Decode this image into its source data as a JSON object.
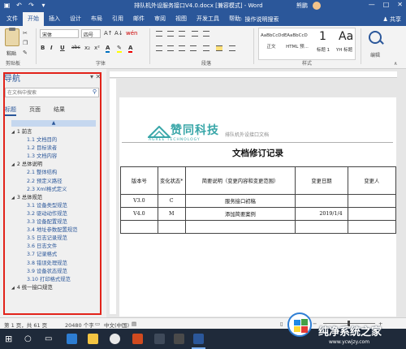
{
  "titlebar": {
    "title": "排队机外设服务接口V4.0.docx [兼容模式] - Word",
    "user": "熊鹏",
    "window_buttons": [
      "—",
      "□",
      "✕"
    ]
  },
  "menu": {
    "tabs": [
      "文件",
      "开始",
      "插入",
      "设计",
      "布局",
      "引用",
      "邮件",
      "审阅",
      "视图",
      "开发工具",
      "帮助"
    ],
    "active_tab": "开始",
    "tell_me": "操作说明搜索",
    "share": "共享"
  },
  "ribbon": {
    "paste_label": "粘贴",
    "font_name": "宋体",
    "font_size": "四号",
    "font_size_btn": "wén",
    "clipboard_label": "剪贴板",
    "font_label": "字体",
    "paragraph_label": "段落",
    "styles_label": "样式",
    "editing_label": "编辑",
    "styles": [
      {
        "preview": "AaBbCcDdE",
        "name": "正文"
      },
      {
        "preview": "AaBbCcD",
        "name": "HTML 预..."
      },
      {
        "preview": "1",
        "name": "标题 1"
      },
      {
        "preview": "Aa",
        "name": "YH 标题"
      }
    ],
    "format_buttons": [
      "B",
      "I",
      "U",
      "abc",
      "x₂",
      "x²"
    ]
  },
  "nav": {
    "title": "导航",
    "search_placeholder": "在文档中搜索",
    "tabs": [
      "标题",
      "页面",
      "结果"
    ],
    "collapse_symbol": "▲",
    "headings": [
      {
        "level": 1,
        "text": "1 前言"
      },
      {
        "level": 2,
        "text": "1.1 文档目的"
      },
      {
        "level": 2,
        "text": "1.2 目标读者"
      },
      {
        "level": 2,
        "text": "1.3 文档内容"
      },
      {
        "level": 1,
        "text": "2 总体说明"
      },
      {
        "level": 2,
        "text": "2.1 整体结构"
      },
      {
        "level": 2,
        "text": "2.2 预定义路径"
      },
      {
        "level": 2,
        "text": "2.3 Xml格式定义"
      },
      {
        "level": 1,
        "text": "3 总体规范"
      },
      {
        "level": 2,
        "text": "3.1 设备类型规范"
      },
      {
        "level": 2,
        "text": "3.2 驱动动作规范"
      },
      {
        "level": 2,
        "text": "3.3 设备配置规范"
      },
      {
        "level": 2,
        "text": "3.4 地址参数配置规范"
      },
      {
        "level": 2,
        "text": "3.5 日志记录规范"
      },
      {
        "level": 2,
        "text": "3.6 日志文件"
      },
      {
        "level": 2,
        "text": "3.7 记录格式"
      },
      {
        "level": 2,
        "text": "3.8 错误处理规范"
      },
      {
        "level": 2,
        "text": "3.9 设备状态规范"
      },
      {
        "level": 2,
        "text": "3.10 打印格式规范"
      },
      {
        "level": 1,
        "text": "4 统一接口规范"
      }
    ]
  },
  "doc": {
    "logo_cn": "赞同科技",
    "logo_en": "AGREE TECHNOLOGY",
    "header_text": "排队机外设接口文档",
    "title": "文档修订记录",
    "table_headers": [
      "版本号",
      "变化状态*",
      "简要说明（变更内容和变更范围）",
      "变更日期",
      "变更人"
    ],
    "table_rows": [
      [
        "V3.0",
        "C",
        "服务接口初稿",
        "",
        ""
      ],
      [
        "V4.0",
        "M",
        "添加简要案例",
        "2019/1/4",
        ""
      ],
      [
        "",
        "",
        "",
        "",
        ""
      ]
    ]
  },
  "status": {
    "page": "第 1 页，共 61 页",
    "words": "20480 个字",
    "language": "中文(中国)"
  },
  "watermark": {
    "cn": "纯净系统之家",
    "url": "www.ycwjzy.com"
  },
  "colors": {
    "word_blue": "#2b579a",
    "highlight_red": "#e2231a",
    "logo_teal": "#38a6a8"
  }
}
